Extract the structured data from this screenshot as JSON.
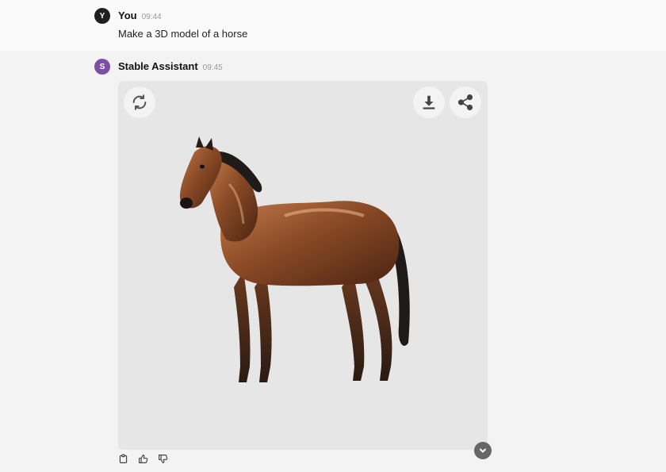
{
  "user_message": {
    "avatar_letter": "Y",
    "author": "You",
    "time": "09:44",
    "text": "Make a 3D model of a horse"
  },
  "assistant_message": {
    "avatar_letter": "S",
    "author": "Stable Assistant",
    "time": "09:45",
    "image_subject": "3D model of a brown horse"
  },
  "icons": {
    "regenerate": "refresh-icon",
    "download": "download-icon",
    "share": "share-icon",
    "copy": "clipboard-icon",
    "like": "thumbs-up-icon",
    "dislike": "thumbs-down-icon",
    "scroll": "chevron-down-icon"
  },
  "colors": {
    "user_avatar": "#1f1f1f",
    "assistant_avatar": "#7b4fa6",
    "card_background": "#e6e6e6"
  }
}
